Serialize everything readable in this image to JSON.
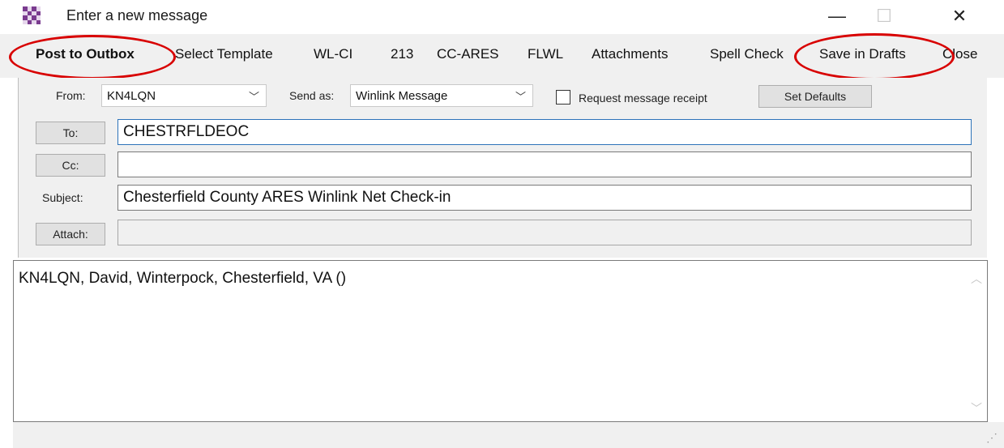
{
  "window": {
    "title": "Enter a new message",
    "minimize_glyph": "—",
    "maximize_glyph": "☐",
    "close_glyph": "✕"
  },
  "menu": {
    "post_to_outbox": "Post to Outbox",
    "select_template": "Select Template",
    "wl_ci": "WL-CI",
    "n213": "213",
    "cc_ares": "CC-ARES",
    "flwl": "FLWL",
    "attachments": "Attachments",
    "spell_check": "Spell Check",
    "save_in_drafts": "Save in Drafts",
    "close": "Close"
  },
  "header": {
    "from_label": "From:",
    "from_value": "KN4LQN",
    "send_as_label": "Send as:",
    "send_as_value": "Winlink Message",
    "request_receipt_label": "Request message receipt",
    "request_receipt_checked": false,
    "set_defaults_label": "Set Defaults",
    "to_button": "To:",
    "to_value": "CHESTRFLDEOC",
    "cc_button": "Cc:",
    "cc_value": "",
    "subject_label": "Subject:",
    "subject_value": "Chesterfield County ARES Winlink Net Check-in",
    "attach_button": "Attach:",
    "attach_value": ""
  },
  "body": {
    "text": "KN4LQN, David, Winterpock, Chesterfield, VA ()"
  },
  "icons": {
    "app": "checkered-app-icon",
    "dropdown": "chevron-down-icon",
    "scroll_up": "scroll-up-arrow-icon",
    "scroll_down": "scroll-down-arrow-icon",
    "grip": "resize-grip-icon"
  },
  "colors": {
    "highlight_ring": "#d80000",
    "focus_border": "#2d73b9",
    "panel_bg": "#f0f0f0"
  }
}
